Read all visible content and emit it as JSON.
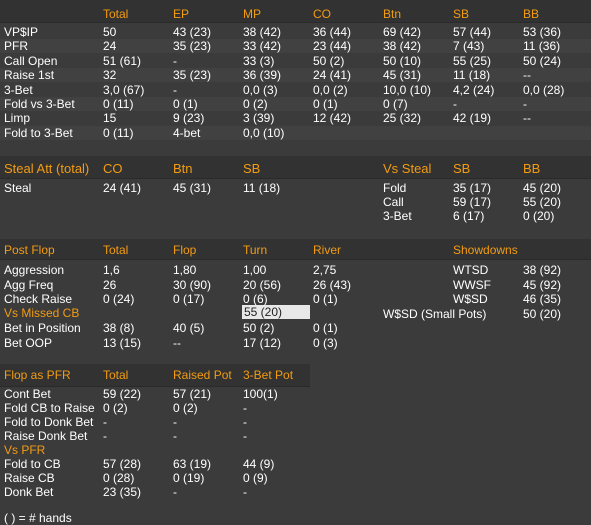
{
  "summary": {
    "columns": [
      "Total",
      "EP",
      "MP",
      "CO",
      "Btn",
      "SB",
      "BB"
    ],
    "rows": [
      {
        "label": "VP$IP",
        "cells": [
          "50",
          "43 (23)",
          "38 (42)",
          "36 (44)",
          "69 (42)",
          "57 (44)",
          "53 (36)"
        ]
      },
      {
        "label": "PFR",
        "cells": [
          "24",
          "35 (23)",
          "33 (42)",
          "23 (44)",
          "38 (42)",
          "7 (43)",
          "11 (36)"
        ]
      },
      {
        "label": "Call Open",
        "cells": [
          "51 (61)",
          "-",
          "33 (3)",
          "50 (2)",
          "50 (10)",
          "55 (25)",
          "50 (24)"
        ]
      },
      {
        "label": "Raise 1st",
        "cells": [
          "32",
          "35 (23)",
          "36 (39)",
          "24 (41)",
          "45 (31)",
          "11 (18)",
          "--"
        ]
      },
      {
        "label": "3-Bet",
        "cells": [
          "3,0 (67)",
          "-",
          "0,0 (3)",
          "0,0 (2)",
          "10,0 (10)",
          "4,2 (24)",
          "0,0 (28)"
        ]
      },
      {
        "label": "Fold vs 3-Bet",
        "cells": [
          "0 (11)",
          "0 (1)",
          "0 (2)",
          "0 (1)",
          "0 (7)",
          "-",
          "-"
        ]
      },
      {
        "label": "Limp",
        "cells": [
          "15",
          "9 (23)",
          "3 (39)",
          "12 (42)",
          "25 (32)",
          "42 (19)",
          "--"
        ]
      },
      {
        "label": "Fold to 3-Bet",
        "cells": [
          "0 (11)",
          "4-bet",
          "0,0 (10)",
          "",
          "",
          "",
          ""
        ]
      }
    ]
  },
  "steal": {
    "header": [
      "Steal Att (total)",
      "CO",
      "Btn",
      "SB"
    ],
    "row": {
      "label": "Steal",
      "cells": [
        "24 (41)",
        "45 (31)",
        "11 (18)"
      ]
    },
    "vs_steal": {
      "header": [
        "Vs Steal",
        "SB",
        "BB"
      ],
      "rows": [
        {
          "label": "Fold",
          "cells": [
            "35 (17)",
            "45 (20)"
          ]
        },
        {
          "label": "Call",
          "cells": [
            "59 (17)",
            "55 (20)"
          ]
        },
        {
          "label": "3-Bet",
          "cells": [
            "6 (17)",
            "0 (20)"
          ]
        }
      ]
    }
  },
  "postflop": {
    "header": [
      "Post Flop",
      "Total",
      "Flop",
      "Turn",
      "River"
    ],
    "rows": [
      {
        "label": "Aggression",
        "cells": [
          "1,6",
          "1,80",
          "1,00",
          "2,75"
        ]
      },
      {
        "label": "Agg Freq",
        "cells": [
          "26",
          "30 (90)",
          "20 (56)",
          "26 (43)"
        ]
      },
      {
        "label": "Check Raise",
        "cells": [
          "0 (24)",
          "0 (17)",
          "0 (6)",
          "0 (1)"
        ]
      }
    ],
    "vs_missed_cb": {
      "label": "Vs Missed CB",
      "turn": "55 (20)"
    },
    "rows2": [
      {
        "label": "Bet in Position",
        "cells": [
          "38 (8)",
          "40 (5)",
          "50 (2)",
          "0 (1)"
        ]
      },
      {
        "label": "Bet OOP",
        "cells": [
          "13 (15)",
          "--",
          "17 (12)",
          "0 (3)"
        ]
      }
    ],
    "showdowns": {
      "header": "Showdowns",
      "rows": [
        {
          "label": "WTSD",
          "value": "38 (92)"
        },
        {
          "label": "WWSF",
          "value": "45 (92)"
        },
        {
          "label": "W$SD",
          "value": "46 (35)"
        },
        {
          "label": "W$SD (Small Pots)",
          "value": "50 (20)"
        }
      ]
    }
  },
  "flop_pfr": {
    "header": [
      "Flop as PFR",
      "Total",
      "Raised Pot",
      "3-Bet Pot"
    ],
    "rows": [
      {
        "label": "Cont Bet",
        "cells": [
          "59 (22)",
          "57 (21)",
          "100(1)"
        ]
      },
      {
        "label": "Fold CB to Raise",
        "cells": [
          "0 (2)",
          "0 (2)",
          "-"
        ]
      },
      {
        "label": "Fold to Donk Bet",
        "cells": [
          "-",
          "-",
          "-"
        ]
      },
      {
        "label": "Raise Donk Bet",
        "cells": [
          "-",
          "-",
          "-"
        ]
      }
    ],
    "vs_pfr_label": "Vs PFR",
    "rows2": [
      {
        "label": "Fold to CB",
        "cells": [
          "57 (28)",
          "63 (19)",
          "44 (9)"
        ]
      },
      {
        "label": "Raise CB",
        "cells": [
          "0 (28)",
          "0 (19)",
          "0 (9)"
        ]
      },
      {
        "label": "Donk Bet",
        "cells": [
          "23 (35)",
          "-",
          "-"
        ]
      }
    ]
  },
  "footnote": "( ) = # hands"
}
